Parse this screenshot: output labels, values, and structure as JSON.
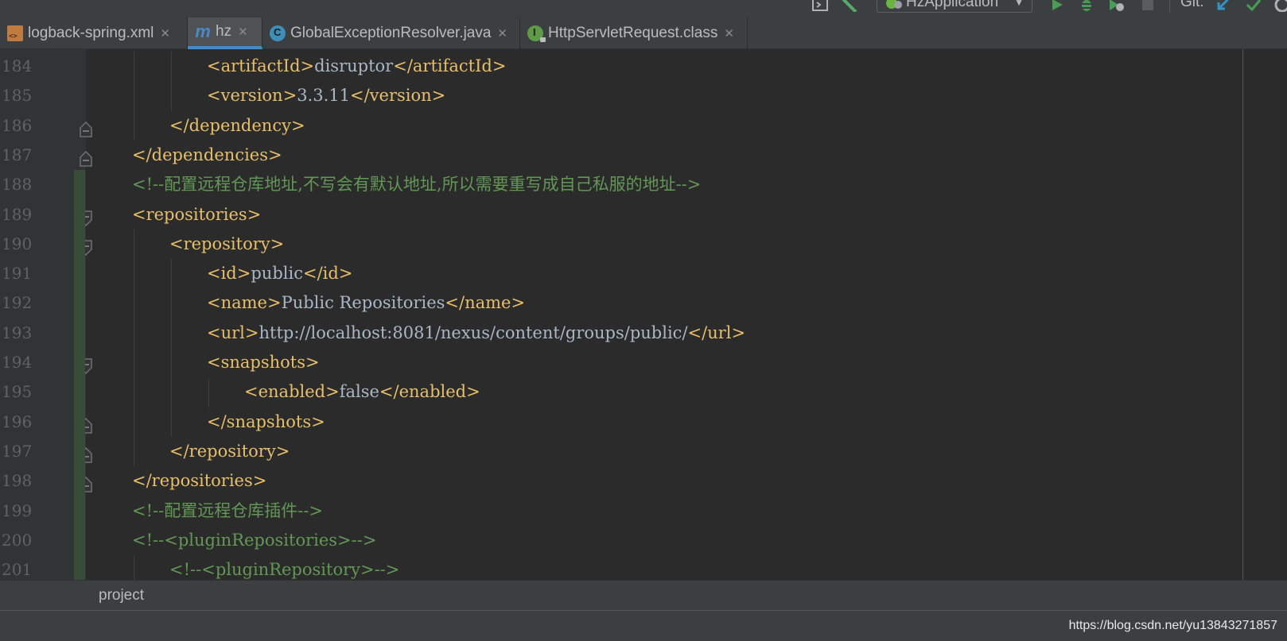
{
  "toolbar": {
    "run_config": "HzApplication",
    "git_label": "Git:"
  },
  "tabs": [
    {
      "label": "logback-spring.xml",
      "icon": "xml-file-icon",
      "active": false
    },
    {
      "label": "hz",
      "icon": "maven-icon",
      "active": true
    },
    {
      "label": "GlobalExceptionResolver.java",
      "icon": "class-icon",
      "active": false
    },
    {
      "label": "HttpServletRequest.class",
      "icon": "interface-icon",
      "active": false
    }
  ],
  "editor": {
    "lines": [
      {
        "no": "184",
        "indent": 3,
        "parts": [
          [
            "tag",
            "<artifactId>"
          ],
          [
            "txt",
            "disruptor"
          ],
          [
            "tag",
            "</artifactId>"
          ]
        ]
      },
      {
        "no": "185",
        "indent": 3,
        "parts": [
          [
            "tag",
            "<version>"
          ],
          [
            "txt",
            "3.3.11"
          ],
          [
            "tag",
            "</version>"
          ]
        ]
      },
      {
        "no": "186",
        "indent": 2,
        "parts": [
          [
            "tag",
            "</dependency>"
          ]
        ]
      },
      {
        "no": "187",
        "indent": 1,
        "parts": [
          [
            "tag",
            "</dependencies>"
          ]
        ]
      },
      {
        "no": "188",
        "indent": 1,
        "parts": [
          [
            "cmt",
            "<!--配置远程仓库地址,不写会有默认地址,所以需要重写成自己私服的地址-->"
          ]
        ]
      },
      {
        "no": "189",
        "indent": 1,
        "parts": [
          [
            "tag",
            "<repositories>"
          ]
        ]
      },
      {
        "no": "190",
        "indent": 2,
        "parts": [
          [
            "tag",
            "<repository>"
          ]
        ]
      },
      {
        "no": "191",
        "indent": 3,
        "parts": [
          [
            "tag",
            "<id>"
          ],
          [
            "txt",
            "public"
          ],
          [
            "tag",
            "</id>"
          ]
        ]
      },
      {
        "no": "192",
        "indent": 3,
        "parts": [
          [
            "tag",
            "<name>"
          ],
          [
            "txt",
            "Public Repositories"
          ],
          [
            "tag",
            "</name>"
          ]
        ]
      },
      {
        "no": "193",
        "indent": 3,
        "parts": [
          [
            "tag",
            "<url>"
          ],
          [
            "txt",
            "http://localhost:8081/nexus/content/groups/public/"
          ],
          [
            "tag",
            "</url>"
          ]
        ]
      },
      {
        "no": "194",
        "indent": 3,
        "parts": [
          [
            "tag",
            "<snapshots>"
          ]
        ]
      },
      {
        "no": "195",
        "indent": 4,
        "parts": [
          [
            "tag",
            "<enabled>"
          ],
          [
            "txt",
            "false"
          ],
          [
            "tag",
            "</enabled>"
          ]
        ]
      },
      {
        "no": "196",
        "indent": 3,
        "parts": [
          [
            "tag",
            "</snapshots>"
          ]
        ]
      },
      {
        "no": "197",
        "indent": 2,
        "parts": [
          [
            "tag",
            "</repository>"
          ]
        ]
      },
      {
        "no": "198",
        "indent": 1,
        "parts": [
          [
            "tag",
            "</repositories>"
          ]
        ]
      },
      {
        "no": "199",
        "indent": 1,
        "parts": [
          [
            "cmt",
            "<!--配置远程仓库插件-->"
          ]
        ]
      },
      {
        "no": "200",
        "indent": 1,
        "parts": [
          [
            "cmt",
            "<!--<pluginRepositories>-->"
          ]
        ]
      },
      {
        "no": "201",
        "indent": 2,
        "parts": [
          [
            "cmt",
            "<!--<pluginRepository>-->"
          ]
        ]
      }
    ],
    "fold_lines": [
      "186",
      "187",
      "189",
      "190",
      "194",
      "196",
      "197",
      "198"
    ],
    "changed_lines": [
      "188",
      "189",
      "190",
      "191",
      "192",
      "193",
      "194",
      "195",
      "196",
      "197",
      "198",
      "199",
      "200",
      "201"
    ]
  },
  "breadcrumb": {
    "text": "project"
  },
  "status": {
    "watermark": "https://blog.csdn.net/yu13843271857"
  },
  "colors": {
    "tag": "#e8bf6a",
    "text": "#a9b7c6",
    "comment": "#629755",
    "accent": "#4a88c7"
  }
}
